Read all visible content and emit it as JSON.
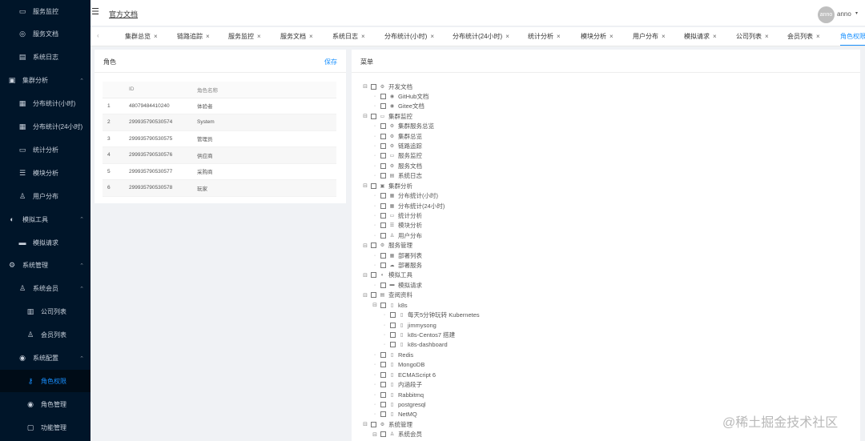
{
  "sidebar": {
    "items": [
      {
        "label": "服务监控",
        "icon": "monitor-icon",
        "level": 1,
        "arrow": ""
      },
      {
        "label": "服务文档",
        "icon": "document-icon",
        "level": 1,
        "arrow": ""
      },
      {
        "label": "系统日志",
        "icon": "log-icon",
        "level": 1,
        "arrow": ""
      },
      {
        "label": "集群分析",
        "icon": "cluster-icon",
        "level": 0,
        "arrow": "⌃"
      },
      {
        "label": "分布统计(小时)",
        "icon": "stats-icon",
        "level": 1,
        "arrow": ""
      },
      {
        "label": "分布统计(24小时)",
        "icon": "stats-icon",
        "level": 1,
        "arrow": ""
      },
      {
        "label": "统计分析",
        "icon": "desktop-icon",
        "level": 1,
        "arrow": ""
      },
      {
        "label": "模块分析",
        "icon": "sliders-icon",
        "level": 1,
        "arrow": ""
      },
      {
        "label": "用户分布",
        "icon": "user-icon",
        "level": 1,
        "arrow": ""
      },
      {
        "label": "模拟工具",
        "icon": "tool-icon",
        "level": 0,
        "arrow": "⌃"
      },
      {
        "label": "模拟请求",
        "icon": "request-icon",
        "level": 1,
        "arrow": ""
      },
      {
        "label": "系统管理",
        "icon": "gear-icon",
        "level": 0,
        "arrow": "⌃"
      },
      {
        "label": "系统会员",
        "icon": "members-icon",
        "level": 1,
        "arrow": "⌃"
      },
      {
        "label": "公司列表",
        "icon": "company-icon",
        "level": 2,
        "arrow": ""
      },
      {
        "label": "会员列表",
        "icon": "user-icon",
        "level": 2,
        "arrow": ""
      },
      {
        "label": "系统配置",
        "icon": "location-icon",
        "level": 1,
        "arrow": "⌃"
      },
      {
        "label": "角色权限",
        "icon": "key-icon",
        "level": 2,
        "arrow": "",
        "active": true
      },
      {
        "label": "角色管理",
        "icon": "eye-icon",
        "level": 2,
        "arrow": ""
      },
      {
        "label": "功能管理",
        "icon": "function-icon",
        "level": 2,
        "arrow": ""
      }
    ]
  },
  "header": {
    "menu_icon": "☰",
    "title": "官方文档",
    "avatar_text": "anno",
    "user_name": "anno",
    "caret": "▾"
  },
  "tabs": {
    "prev": "‹",
    "close": "×",
    "items": [
      {
        "label": "集群总览"
      },
      {
        "label": "链路追踪"
      },
      {
        "label": "服务监控"
      },
      {
        "label": "服务文档"
      },
      {
        "label": "系统日志"
      },
      {
        "label": "分布统计(小时)"
      },
      {
        "label": "分布统计(24小时)"
      },
      {
        "label": "统计分析"
      },
      {
        "label": "模块分析"
      },
      {
        "label": "用户分布"
      },
      {
        "label": "模拟请求"
      },
      {
        "label": "公司列表"
      },
      {
        "label": "会员列表"
      },
      {
        "label": "角色权限",
        "active": true
      }
    ]
  },
  "roles_panel": {
    "title": "角色",
    "save_label": "保存",
    "columns": [
      "",
      "ID",
      "角色名称"
    ],
    "rows": [
      {
        "index": "1",
        "id": "48079484410240",
        "name": "体验者"
      },
      {
        "index": "2",
        "id": "299935790530574",
        "name": "System"
      },
      {
        "index": "3",
        "id": "299935790530575",
        "name": "管理员"
      },
      {
        "index": "4",
        "id": "299935790530576",
        "name": "供应商"
      },
      {
        "index": "5",
        "id": "299935790530577",
        "name": "采购商"
      },
      {
        "index": "6",
        "id": "299935790530578",
        "name": "玩家"
      }
    ]
  },
  "menu_panel": {
    "title": "菜单",
    "nodes": [
      {
        "label": "开发文档",
        "level": 0,
        "expandable": true,
        "icon": "gear-icon"
      },
      {
        "label": "GitHub文档",
        "level": 1,
        "expandable": false,
        "icon": "location-icon"
      },
      {
        "label": "Gitee文档",
        "level": 1,
        "expandable": false,
        "icon": "location-icon"
      },
      {
        "label": "集群监控",
        "level": 0,
        "expandable": true,
        "icon": "monitor-icon"
      },
      {
        "label": "集群服务总览",
        "level": 1,
        "expandable": false,
        "icon": "gear-icon"
      },
      {
        "label": "集群总览",
        "level": 1,
        "expandable": false,
        "icon": "gear-icon"
      },
      {
        "label": "链路追踪",
        "level": 1,
        "expandable": false,
        "icon": "gear-icon"
      },
      {
        "label": "服务监控",
        "level": 1,
        "expandable": false,
        "icon": "monitor-icon"
      },
      {
        "label": "服务文档",
        "level": 1,
        "expandable": false,
        "icon": "gear-icon"
      },
      {
        "label": "系统日志",
        "level": 1,
        "expandable": false,
        "icon": "log-icon"
      },
      {
        "label": "集群分析",
        "level": 0,
        "expandable": true,
        "icon": "cluster-icon"
      },
      {
        "label": "分布统计(小时)",
        "level": 1,
        "expandable": false,
        "icon": "stats-icon"
      },
      {
        "label": "分布统计(24小时)",
        "level": 1,
        "expandable": false,
        "icon": "stats-icon"
      },
      {
        "label": "统计分析",
        "level": 1,
        "expandable": false,
        "icon": "desktop-icon"
      },
      {
        "label": "模块分析",
        "level": 1,
        "expandable": false,
        "icon": "sliders-icon"
      },
      {
        "label": "用户分布",
        "level": 1,
        "expandable": false,
        "icon": "user-icon"
      },
      {
        "label": "服务管理",
        "level": 0,
        "expandable": true,
        "icon": "gear-icon"
      },
      {
        "label": "部署列表",
        "level": 1,
        "expandable": false,
        "icon": "grid-icon"
      },
      {
        "label": "部署服务",
        "level": 1,
        "expandable": false,
        "icon": "cloud-icon"
      },
      {
        "label": "模拟工具",
        "level": 0,
        "expandable": true,
        "icon": "tool-icon"
      },
      {
        "label": "模拟请求",
        "level": 1,
        "expandable": false,
        "icon": "request-icon"
      },
      {
        "label": "查阅资料",
        "level": 0,
        "expandable": true,
        "icon": "book-icon"
      },
      {
        "label": "k8s",
        "level": 1,
        "expandable": true,
        "icon": "file-icon"
      },
      {
        "label": "每天5分钟玩转 Kubernetes",
        "level": 2,
        "expandable": false,
        "icon": "file-icon"
      },
      {
        "label": "jimmysong",
        "level": 2,
        "expandable": false,
        "icon": "file-icon"
      },
      {
        "label": "k8s-Centos7 搭建",
        "level": 2,
        "expandable": false,
        "icon": "file-icon"
      },
      {
        "label": "k8s-dashboard",
        "level": 2,
        "expandable": false,
        "icon": "file-icon"
      },
      {
        "label": "Redis",
        "level": 1,
        "expandable": false,
        "icon": "file-icon"
      },
      {
        "label": "MongoDB",
        "level": 1,
        "expandable": false,
        "icon": "file-icon"
      },
      {
        "label": "ECMAScript 6",
        "level": 1,
        "expandable": false,
        "icon": "file-icon"
      },
      {
        "label": "内涵段子",
        "level": 1,
        "expandable": false,
        "icon": "file-icon"
      },
      {
        "label": "Rabbitmq",
        "level": 1,
        "expandable": false,
        "icon": "file-icon"
      },
      {
        "label": "postgresql",
        "level": 1,
        "expandable": false,
        "icon": "file-icon"
      },
      {
        "label": "NetMQ",
        "level": 1,
        "expandable": false,
        "icon": "file-icon"
      },
      {
        "label": "系统管理",
        "level": 0,
        "expandable": true,
        "icon": "gear-icon"
      },
      {
        "label": "系统会员",
        "level": 1,
        "expandable": true,
        "icon": "user-icon"
      }
    ]
  },
  "watermark": "@稀土掘金技术社区",
  "colors": {
    "sidebar_bg": "#001529",
    "accent": "#1890ff",
    "content_bg": "#f0f2f5"
  }
}
